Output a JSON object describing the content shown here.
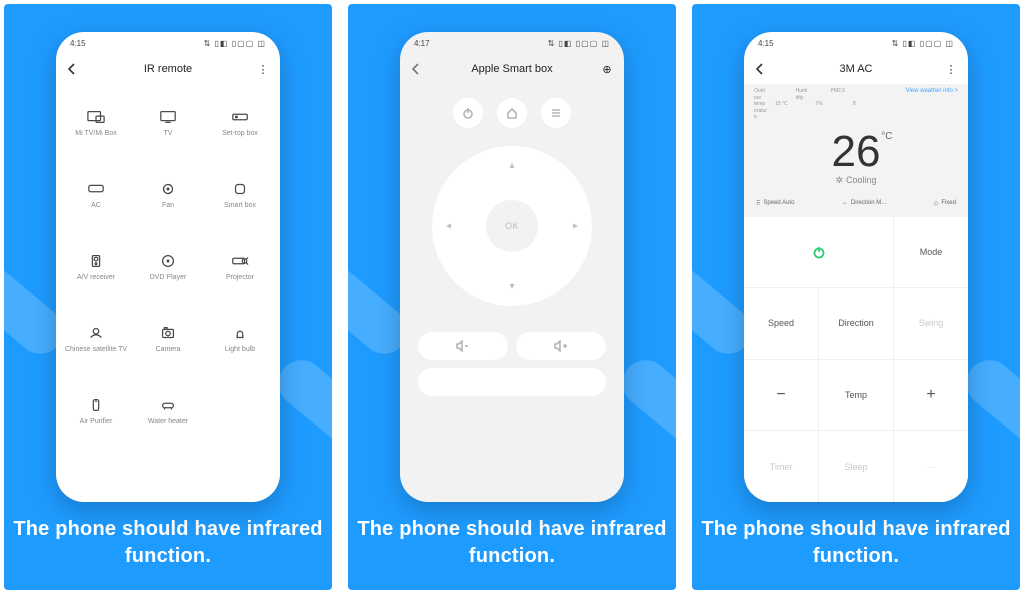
{
  "caption": "The phone should have infrared function.",
  "screen1": {
    "time": "4:15",
    "status_right": "⇅ ▯◧ ▯▢▢ ◫",
    "title": "IR remote",
    "more_glyph": "⋮",
    "devices": [
      "Mi TV/Mi Box",
      "TV",
      "Set-top box",
      "AC",
      "Fan",
      "Smart box",
      "A/V receiver",
      "DVD Player",
      "Projector",
      "Chinese satellite TV",
      "Camera",
      "Light bulb",
      "Air Purifier",
      "Water heater"
    ]
  },
  "screen2": {
    "time": "4:17",
    "status_right": "⇅ ▯◧ ▯▢▢ ◫",
    "title": "Apple Smart box",
    "action_glyph": "⊕",
    "ok_label": "OK"
  },
  "screen3": {
    "time": "4:15",
    "status_right": "⇅ ▯◧ ▯▢▢ ◫",
    "title": "3M AC",
    "more_glyph": "⋮",
    "info": {
      "outdoor_label": "Outd\noor\ntemp\neratur\ne",
      "outdoor_value": "15 °C",
      "humi_label": "Humi\ndity",
      "humi_value": "7%",
      "pm_label": "PM2.5",
      "pm_value": "8",
      "view_label": "View weather info >"
    },
    "temperature": "26",
    "degree": "°C",
    "mode_text": "Cooling",
    "strip": {
      "speed": "Speed Auto",
      "direction": "Direction M...",
      "swing": "Fixed"
    },
    "buttons": {
      "mode": "Mode",
      "speed": "Speed",
      "direction": "Direction",
      "swing": "Swing",
      "temp": "Temp",
      "timer": "Timer",
      "sleep": "Sleep",
      "more": "···"
    }
  }
}
